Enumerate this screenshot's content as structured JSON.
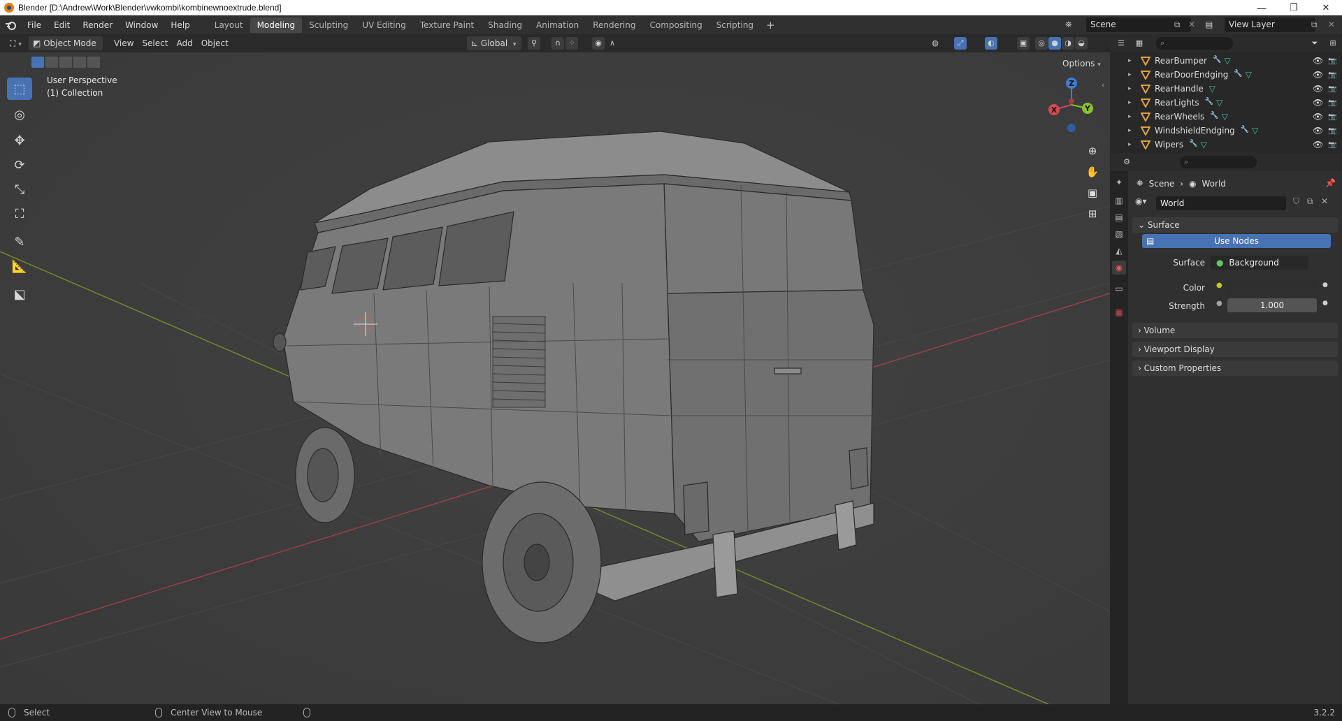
{
  "window": {
    "title": "Blender [D:\\Andrew\\Work\\Blender\\vwkombi\\kombinewnoextrude.blend]",
    "controls": [
      "—",
      "❐",
      "✕"
    ]
  },
  "menubar": {
    "menus": [
      "File",
      "Edit",
      "Render",
      "Window",
      "Help"
    ],
    "workspaces": [
      "Layout",
      "Modeling",
      "Sculpting",
      "UV Editing",
      "Texture Paint",
      "Shading",
      "Animation",
      "Rendering",
      "Compositing",
      "Scripting"
    ],
    "active_workspace": "Modeling",
    "add_workspace": "+",
    "scene": "Scene",
    "view_layer": "View Layer"
  },
  "viewport_header": {
    "mode": "Object Mode",
    "menus": [
      "View",
      "Select",
      "Add",
      "Object"
    ],
    "transform_orientation": "Global",
    "options": "Options"
  },
  "viewport": {
    "view_name": "User Perspective",
    "collection": "(1) Collection",
    "gizmo": {
      "z": "Z",
      "x": "X",
      "y": "Y"
    }
  },
  "toolbar": {
    "tools": [
      "select-box",
      "cursor",
      "move",
      "rotate",
      "scale",
      "transform",
      "annotate",
      "measure",
      "add-cube"
    ],
    "active": "select-box"
  },
  "outliner": {
    "search_placeholder": "",
    "rows": [
      {
        "name": "RearBumper",
        "mods": [
          "wrench",
          "mesh"
        ]
      },
      {
        "name": "RearDoorEndging",
        "mods": [
          "wrench",
          "mesh"
        ]
      },
      {
        "name": "RearHandle",
        "mods": [
          "mesh"
        ]
      },
      {
        "name": "RearLights",
        "mods": [
          "wrench",
          "mesh"
        ]
      },
      {
        "name": "RearWheels",
        "mods": [
          "wrench",
          "mesh"
        ]
      },
      {
        "name": "WindshieldEndging",
        "mods": [
          "wrench",
          "mesh"
        ]
      },
      {
        "name": "Wipers",
        "mods": [
          "wrench",
          "mesh"
        ]
      }
    ]
  },
  "properties": {
    "breadcrumb": {
      "scene": "Scene",
      "sep": "›",
      "world": "World"
    },
    "datablock": "World",
    "panels": {
      "surface": "Surface",
      "use_nodes": "Use Nodes",
      "surface_label": "Surface",
      "surface_value": "Background",
      "color_label": "Color",
      "strength_label": "Strength",
      "strength_value": "1.000",
      "volume": "Volume",
      "viewport_display": "Viewport Display",
      "custom_properties": "Custom Properties"
    },
    "colors": {
      "accent": "#4772b3",
      "socket_yellow": "#c7c729",
      "socket_green": "#63c763",
      "socket_grey": "#a1a1a1"
    }
  },
  "statusbar": {
    "left": "Select",
    "middle": "Center View to Mouse",
    "version": "3.2.2"
  }
}
